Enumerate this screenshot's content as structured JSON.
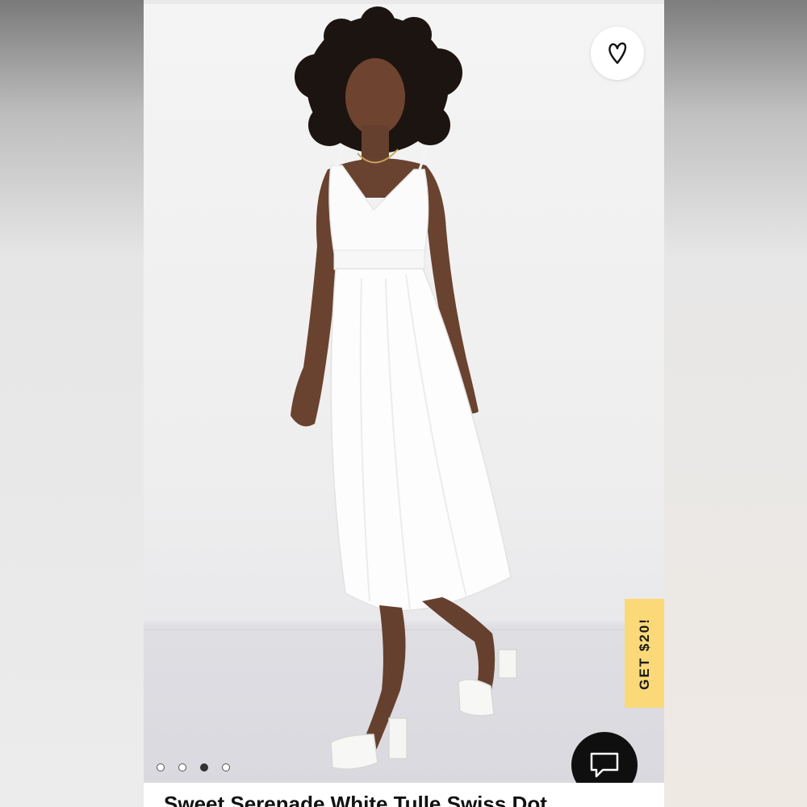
{
  "product": {
    "title": "Sweet Serenade White Tulle Swiss Dot",
    "photo_alt": "Model wearing white tulle midi dress"
  },
  "favorite": {
    "icon": "heart-outline-icon"
  },
  "promo": {
    "label": "GET $20!",
    "color": "#fcd978"
  },
  "carousel": {
    "total": 4,
    "active_index": 3
  },
  "chat": {
    "icon": "chat-bubble-icon"
  }
}
